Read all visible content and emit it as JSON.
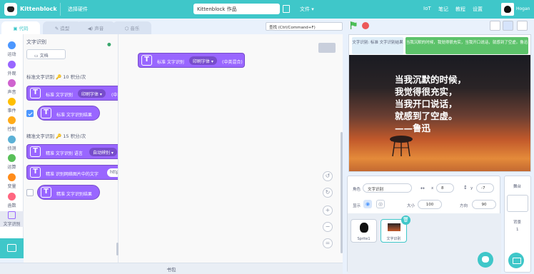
{
  "topbar": {
    "brand": "Kittenblock",
    "menu_select_hardware": "选择硬件",
    "project_title": "Kittenblock 作品",
    "menu_file": "文件 ▾",
    "menu_iot": "IoT",
    "menu_notes": "笔记",
    "menu_tutorials": "教程",
    "menu_settings": "设置",
    "username": "Hogan"
  },
  "tabs": {
    "code": "代码",
    "costumes": "造型",
    "sounds": "声音",
    "backdrops": "音乐"
  },
  "search": {
    "placeholder": "查找 (Ctrl/Command+F)"
  },
  "categories": [
    {
      "label": "运动",
      "color": "#4c97ff"
    },
    {
      "label": "外观",
      "color": "#9966ff"
    },
    {
      "label": "声音",
      "color": "#cf63cf"
    },
    {
      "label": "事件",
      "color": "#ffbf00"
    },
    {
      "label": "控制",
      "color": "#ffab19"
    },
    {
      "label": "侦测",
      "color": "#5cb1d6"
    },
    {
      "label": "运算",
      "color": "#59c059"
    },
    {
      "label": "变量",
      "color": "#ff8c1a"
    },
    {
      "label": "函数",
      "color": "#ff6680"
    },
    {
      "label": "文字识别",
      "color": "#9966ff"
    }
  ],
  "palette": {
    "section_title": "文字识别",
    "doc_button": "文档",
    "standard_header": "标准文字识别 🔑 10 积分/次",
    "std_block_prefix": "标准 文字识别",
    "std_block_dropdown": "印刷字体 ▾",
    "std_block_suffix": "(中英",
    "std_result": "标准 文字识别结果",
    "precise_header": "精准文字识别 🔑 15 积分/次",
    "prec_block_prefix": "精准 文字识别 语言",
    "prec_block_dropdown": "自动辨别 ▾",
    "prec_url_block": "精准 识别网络图片中的文字",
    "prec_url_value": "https:",
    "prec_result": "精准 文字识别结果"
  },
  "script": {
    "block_prefix": "标准 文字识别",
    "block_dropdown": "印刷字体 ▾",
    "block_suffix": "(中英混合)"
  },
  "backpack": "书包",
  "stage": {
    "bubble_left": "文字识别: 标准 文字识别结果",
    "bubble_right": "当我沉默的时候，我觉得很充实，当我开口说话，就感到了空虚。鲁迅",
    "poem": "当我沉默的时候，\n我觉得很充实，\n当我开口说话，\n就感到了空虚。\n——鲁迅"
  },
  "sprite_info": {
    "sprite_label": "角色",
    "sprite_name": "文字识别",
    "x_label": "x",
    "x_value": "8",
    "y_label": "y",
    "y_value": "-7",
    "show_label": "显示",
    "size_label": "大小",
    "size_value": "100",
    "direction_label": "方向",
    "direction_value": "90"
  },
  "sprites": [
    {
      "name": "Sprite1"
    },
    {
      "name": "文字识别"
    }
  ],
  "stage_panel": {
    "title": "舞台",
    "backdrops_label": "背景",
    "backdrops_count": "1"
  },
  "colors": {
    "accent": "#3fc7c9",
    "block": "#9966ff",
    "block_dark": "#774dcb"
  }
}
